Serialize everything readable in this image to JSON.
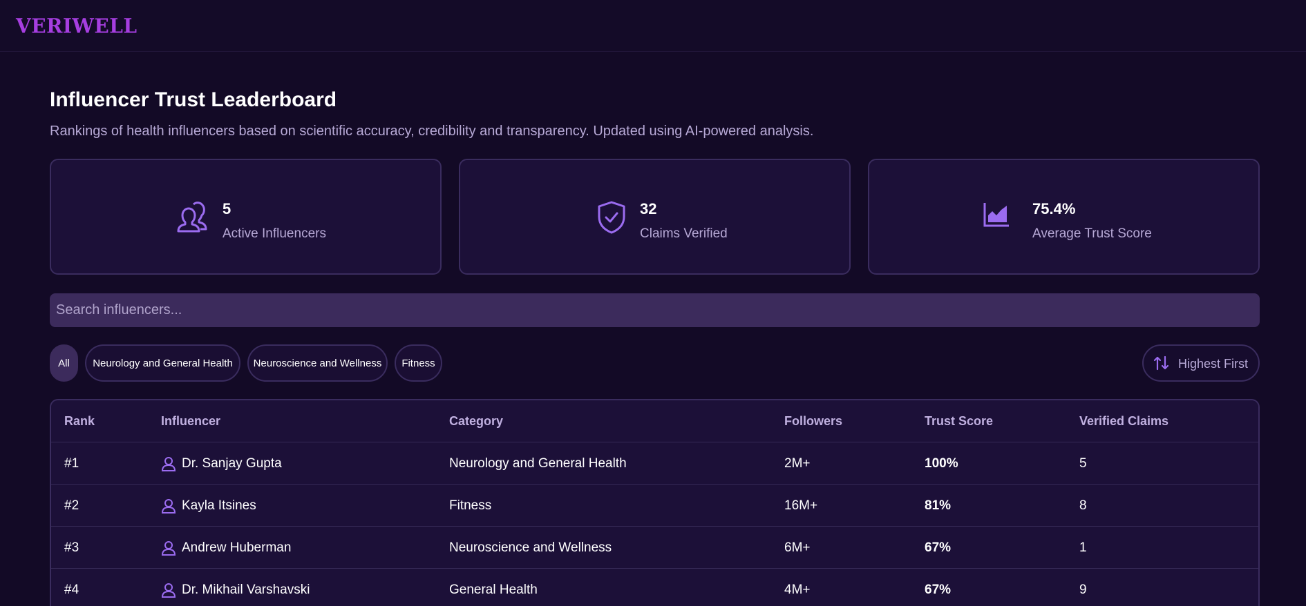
{
  "app": {
    "logo": "VERIWELL"
  },
  "header": {
    "title": "Influencer Trust Leaderboard",
    "subtitle": "Rankings of health influencers based on scientific accuracy, credibility and transparency. Updated using AI-powered analysis."
  },
  "stats": [
    {
      "icon": "users-icon",
      "value": "5",
      "label": "Active Influencers"
    },
    {
      "icon": "shield-check-icon",
      "value": "32",
      "label": "Claims Verified"
    },
    {
      "icon": "area-chart-icon",
      "value": "75.4%",
      "label": "Average Trust Score"
    }
  ],
  "search": {
    "placeholder": "Search influencers...",
    "value": ""
  },
  "filters": {
    "chips": [
      "All",
      "Neurology and General Health",
      "Neuroscience and Wellness",
      "Fitness"
    ],
    "active": "All"
  },
  "sort": {
    "label": "Highest First",
    "icon": "sort-arrows-icon"
  },
  "table": {
    "headers": [
      "Rank",
      "Influencer",
      "Category",
      "Followers",
      "Trust Score",
      "Verified Claims"
    ],
    "rows": [
      {
        "rank": "#1",
        "name": "Dr. Sanjay Gupta",
        "category": "Neurology and General Health",
        "followers": "2M+",
        "trust": "100%",
        "trust_level": "high",
        "claims": "5"
      },
      {
        "rank": "#2",
        "name": "Kayla Itsines",
        "category": "Fitness",
        "followers": "16M+",
        "trust": "81%",
        "trust_level": "high",
        "claims": "8"
      },
      {
        "rank": "#3",
        "name": "Andrew Huberman",
        "category": "Neuroscience and Wellness",
        "followers": "6M+",
        "trust": "67%",
        "trust_level": "mid",
        "claims": "1"
      },
      {
        "rank": "#4",
        "name": "Dr. Mikhail Varshavski",
        "category": "General Health",
        "followers": "4M+",
        "trust": "67%",
        "trust_level": "mid",
        "claims": "9"
      }
    ]
  },
  "colors": {
    "background": "#130a26",
    "card": "#1c1038",
    "accent": "#9b6cf0",
    "logo": "#a63ee0",
    "score_high": "#3ee07a",
    "score_mid": "#f0883a"
  }
}
